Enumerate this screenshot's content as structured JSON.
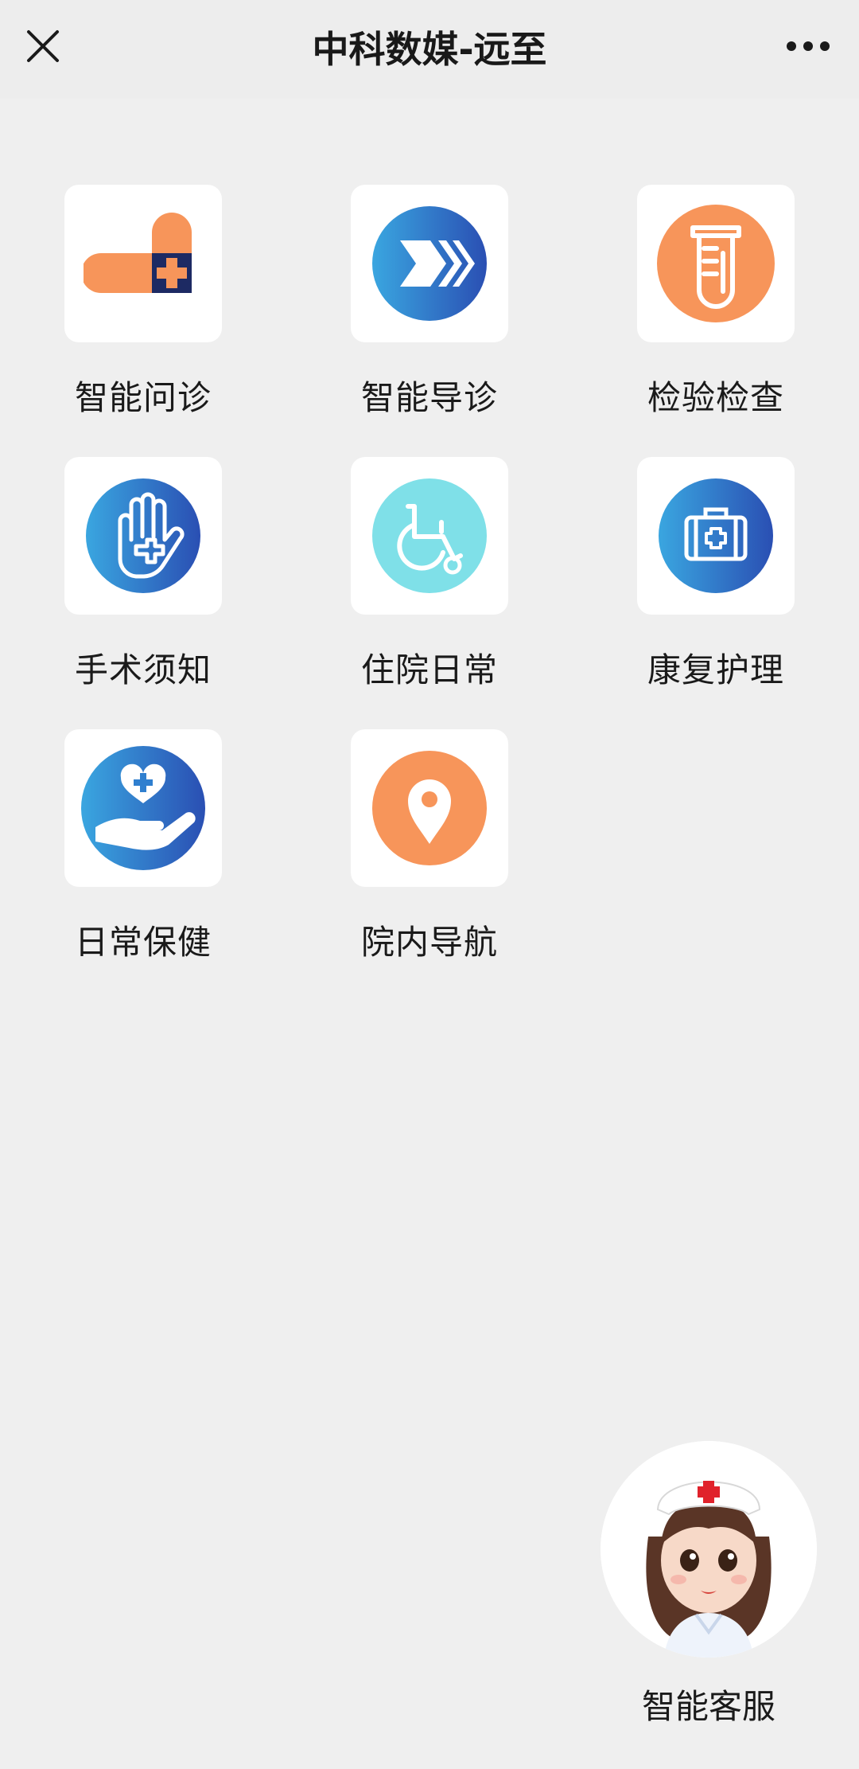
{
  "header": {
    "title": "中科数媒-远至",
    "close_icon": "close-icon",
    "more_icon": "more-icon"
  },
  "grid": {
    "items": [
      {
        "label": "智能问诊",
        "icon": "medical-cross-bandage-icon"
      },
      {
        "label": "智能导诊",
        "icon": "chevron-forward-icon"
      },
      {
        "label": "检验检查",
        "icon": "test-tube-icon"
      },
      {
        "label": "手术须知",
        "icon": "hand-cross-icon"
      },
      {
        "label": "住院日常",
        "icon": "wheelchair-icon"
      },
      {
        "label": "康复护理",
        "icon": "medical-kit-icon"
      },
      {
        "label": "日常保健",
        "icon": "hand-heart-icon"
      },
      {
        "label": "院内导航",
        "icon": "location-pin-icon"
      }
    ]
  },
  "assistant": {
    "label": "智能客服",
    "icon": "nurse-avatar"
  },
  "colors": {
    "orange": "#f7955a",
    "blue_start": "#3aa6e0",
    "blue_end": "#2a4fb3",
    "cyan": "#7fe0e8",
    "navy": "#1d2a63",
    "background": "#efefef"
  }
}
